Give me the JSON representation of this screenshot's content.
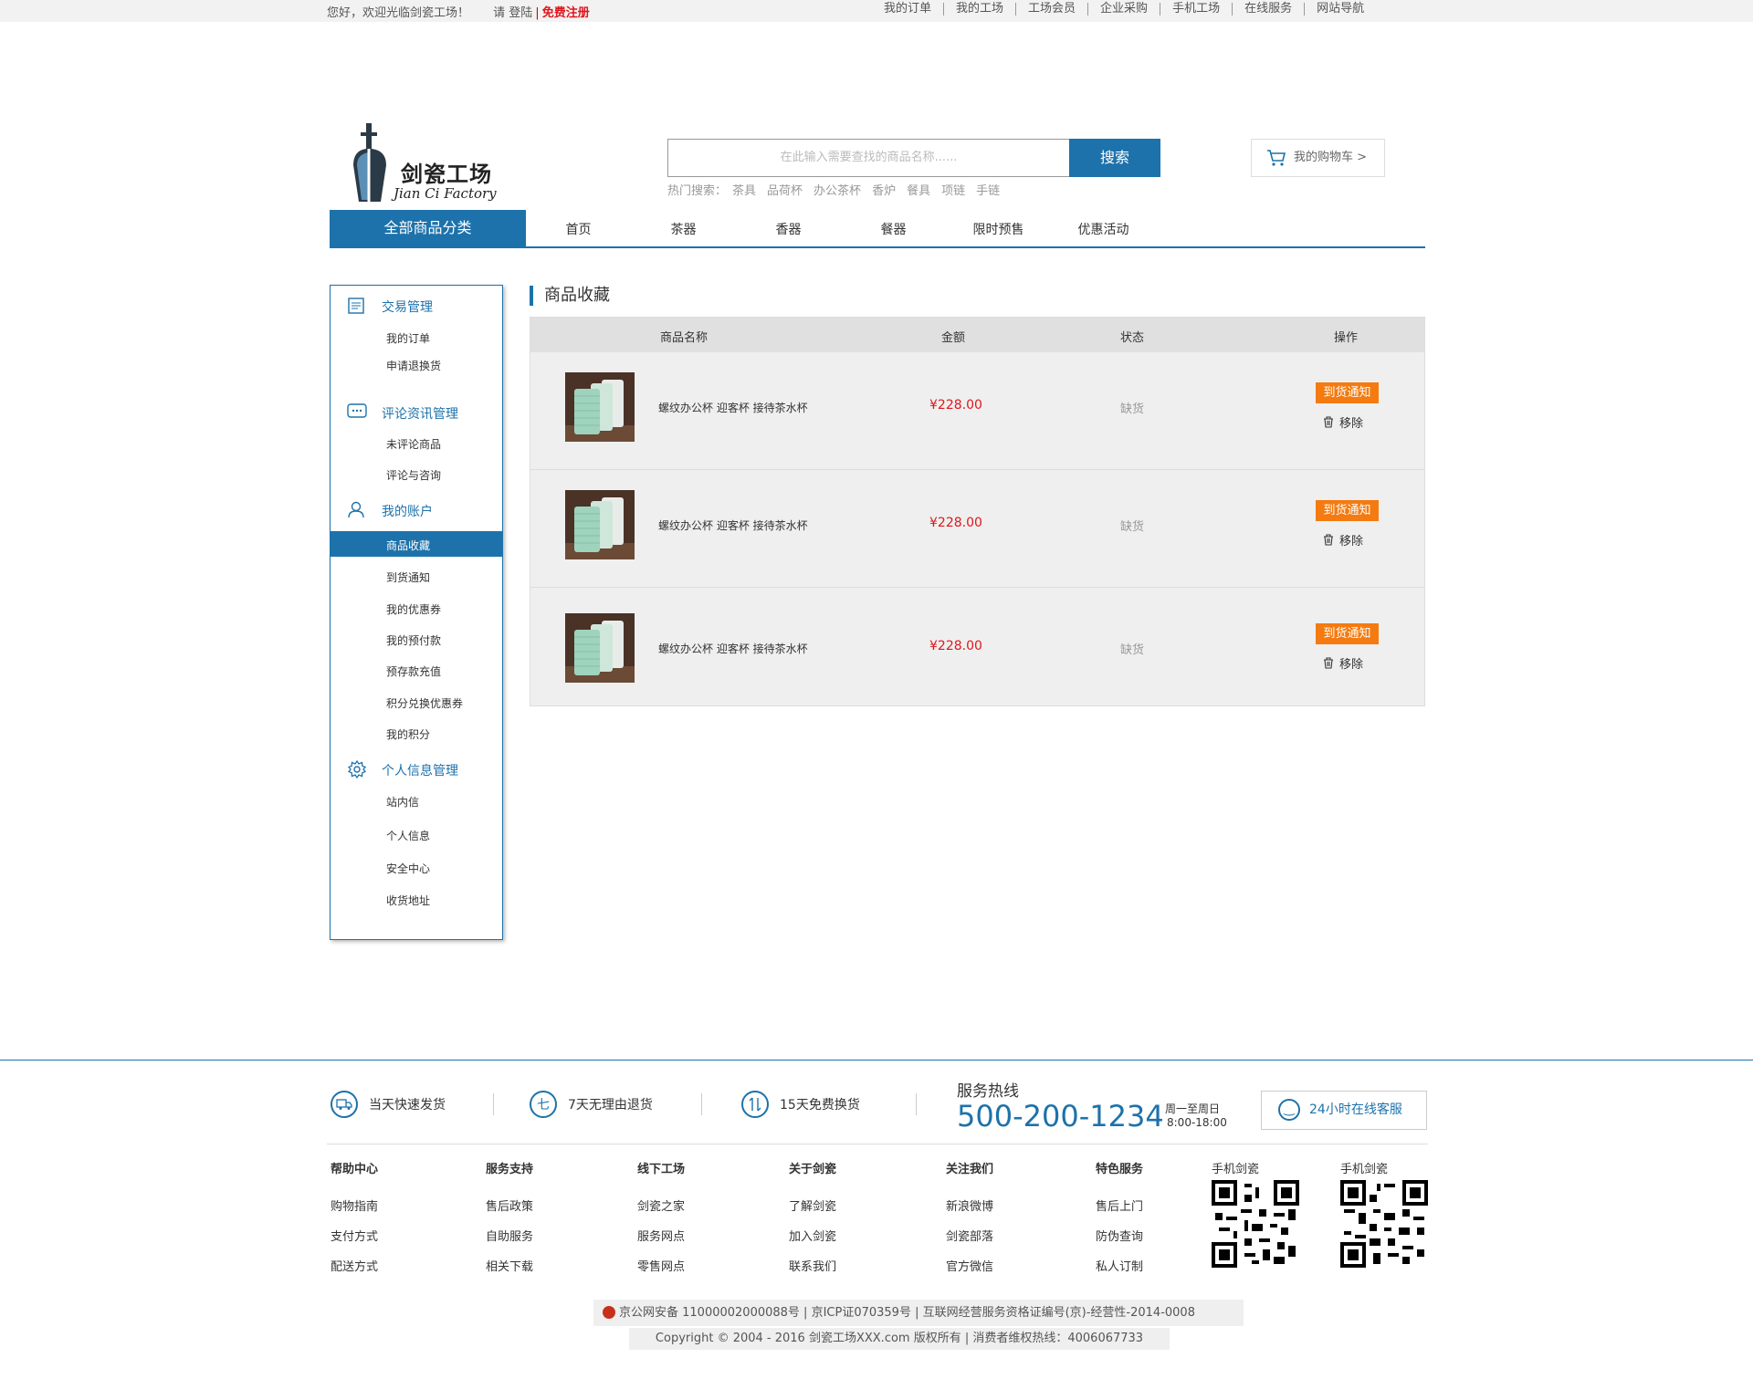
{
  "topbar": {
    "welcome": "您好，欢迎光临剑瓷工场！",
    "login": "请 登陆",
    "register": "免费注册",
    "links": [
      "我的订单",
      "我的工场",
      "工场会员",
      "企业采购",
      "手机工场",
      "在线服务",
      "网站导航"
    ]
  },
  "logo": {
    "cn": "剑瓷工场",
    "en": "Jian Ci Factory"
  },
  "search": {
    "placeholder": "在此输入需要查找的商品名称......",
    "button": "搜索",
    "hot_label": "热门搜索：",
    "hot": [
      "茶具",
      "品荷杯",
      "办公茶杯",
      "香炉",
      "餐具",
      "项链",
      "手链"
    ]
  },
  "cart": {
    "label": "我的购物车 >"
  },
  "nav": {
    "all": "全部商品分类",
    "items": [
      "首页",
      "茶器",
      "香器",
      "餐器",
      "限时预售",
      "优惠活动"
    ]
  },
  "sidebar": {
    "groups": [
      {
        "title": "交易管理",
        "icon": "list-icon",
        "items": [
          "我的订单",
          "申请退换货"
        ]
      },
      {
        "title": "评论资讯管理",
        "icon": "comment-icon",
        "items": [
          "未评论商品",
          "评论与咨询"
        ]
      },
      {
        "title": "我的账户",
        "icon": "user-icon",
        "items": [
          "商品收藏",
          "到货通知",
          "我的优惠券",
          "我的预付款",
          "预存款充值",
          "积分兑换优惠券",
          "我的积分"
        ]
      },
      {
        "title": "个人信息管理",
        "icon": "gear-icon",
        "items": [
          "站内信",
          "个人信息",
          "安全中心",
          "收货地址"
        ]
      }
    ],
    "active": "商品收藏"
  },
  "main": {
    "title": "商品收藏",
    "columns": [
      "商品名称",
      "金额",
      "状态",
      "操作"
    ],
    "rows": [
      {
        "name": "螺纹办公杯 迎客杯 接待茶水杯",
        "price": "¥228.00",
        "status": "缺货",
        "notify": "到货通知",
        "remove": "移除"
      },
      {
        "name": "螺纹办公杯 迎客杯 接待茶水杯",
        "price": "¥228.00",
        "status": "缺货",
        "notify": "到货通知",
        "remove": "移除"
      },
      {
        "name": "螺纹办公杯 迎客杯 接待茶水杯",
        "price": "¥228.00",
        "status": "缺货",
        "notify": "到货通知",
        "remove": "移除"
      }
    ]
  },
  "footer": {
    "services": [
      {
        "icon": "truck-icon",
        "label": "当天快速发货"
      },
      {
        "icon": "seven-day-icon",
        "label": "7天无理由退货",
        "glyph": "七"
      },
      {
        "icon": "exchange-icon",
        "label": "15天免费换货"
      }
    ],
    "hotline_title": "服务热线",
    "hotline_number": "500-200-1234",
    "hours_days": "周一至周日",
    "hours_time": "8:00-18:00",
    "online": "24小时在线客服",
    "columns": [
      {
        "title": "帮助中心",
        "links": [
          "购物指南",
          "支付方式",
          "配送方式"
        ]
      },
      {
        "title": "服务支持",
        "links": [
          "售后政策",
          "自助服务",
          "相关下载"
        ]
      },
      {
        "title": "线下工场",
        "links": [
          "剑瓷之家",
          "服务网点",
          "零售网点"
        ]
      },
      {
        "title": "关于剑瓷",
        "links": [
          "了解剑瓷",
          "加入剑瓷",
          "联系我们"
        ]
      },
      {
        "title": "关注我们",
        "links": [
          "新浪微博",
          "剑瓷部落",
          "官方微信"
        ]
      },
      {
        "title": "特色服务",
        "links": [
          "售后上门",
          "防伪查询",
          "私人订制"
        ]
      }
    ],
    "qr": [
      "手机剑瓷",
      "手机剑瓷"
    ],
    "legal1": "京公网安备 11000002000088号  |   京ICP证070359号  |   互联网经营服务资格证编号(京)-经营性-2014-0008",
    "legal2": "Copyright © 2004 - 2016  剑瓷工场XXX.com 版权所有  |  消费者维权热线：4006067733"
  },
  "colors": {
    "brand": "#1d72ab",
    "price": "#e0161c",
    "notify": "#f47b11"
  }
}
